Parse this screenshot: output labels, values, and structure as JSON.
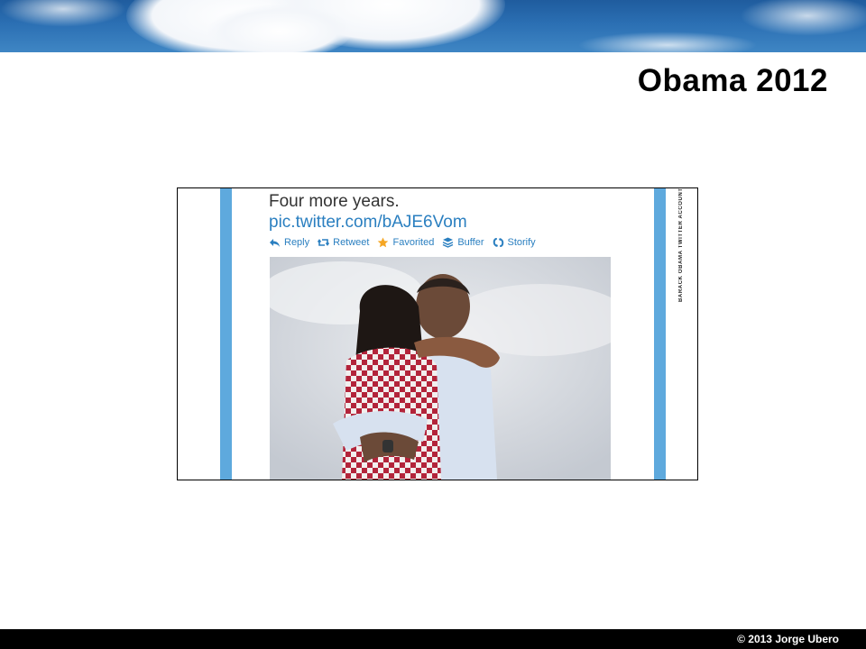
{
  "slide": {
    "title": "Obama 2012",
    "copyright": "© 2013 Jorge Ubero"
  },
  "tweet": {
    "text": "Four more years.",
    "link": "pic.twitter.com/bAJE6Vom",
    "actions": [
      {
        "label": "Reply",
        "icon": "reply-icon"
      },
      {
        "label": "Retweet",
        "icon": "retweet-icon"
      },
      {
        "label": "Favorited",
        "icon": "star-icon"
      },
      {
        "label": "Buffer",
        "icon": "buffer-icon"
      },
      {
        "label": "Storify",
        "icon": "storify-icon"
      }
    ],
    "credit": "BARACK OBAMA TWITTER ACCOUNT"
  },
  "colors": {
    "link_blue": "#2a7fc0",
    "side_bar_blue": "#5ea9dd",
    "favorite_star": "#f5a623",
    "footer_bg": "#000000"
  }
}
